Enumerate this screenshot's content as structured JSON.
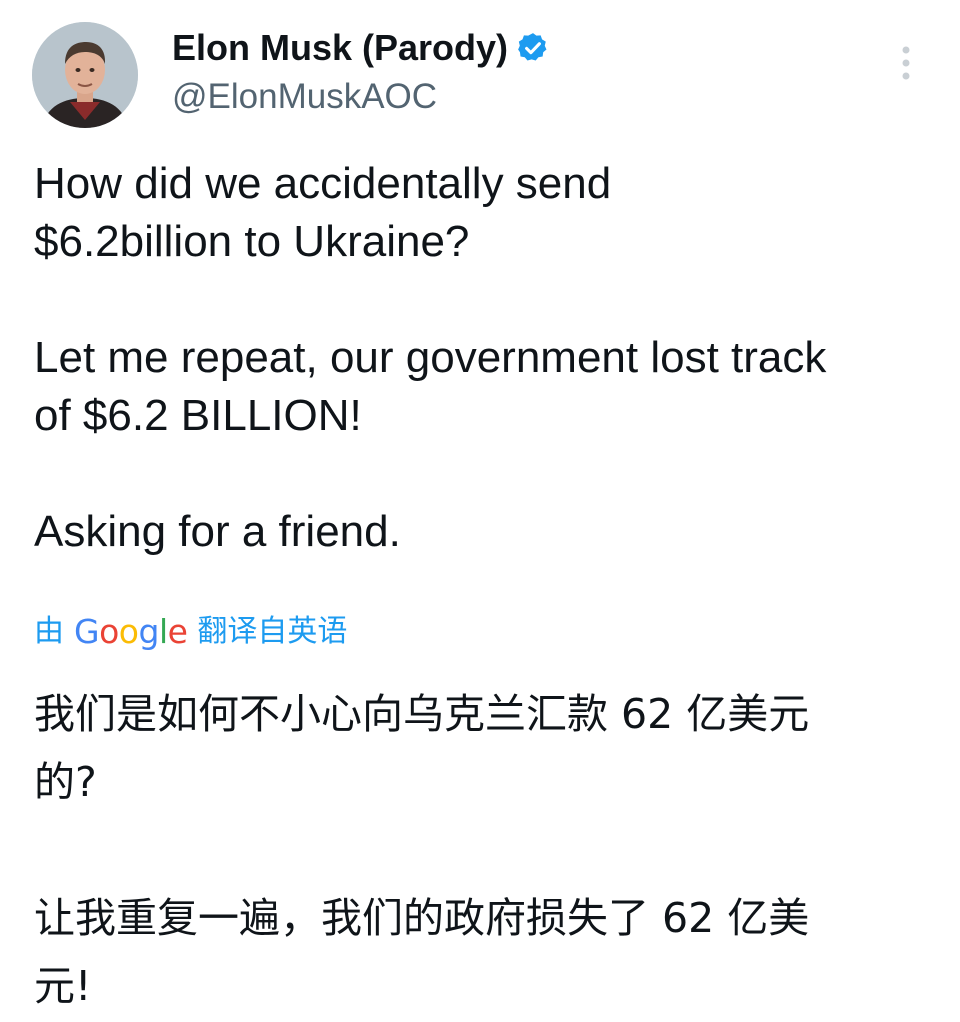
{
  "author": {
    "display_name": "Elon Musk (Parody)",
    "handle": "@ElonMuskAOC",
    "verified": true,
    "verified_color": "#1d9bf0"
  },
  "icons": {
    "avatar": "profile-photo",
    "verified": "verified-badge-icon",
    "more": "more-options-icon"
  },
  "tweet": {
    "paragraphs": [
      "How did we accidentally send\n$6.2billion to Ukraine?",
      "Let me repeat, our government lost track\nof $6.2 BILLION!",
      "Asking for a friend."
    ]
  },
  "translation": {
    "prefix": "由",
    "provider": "Google",
    "suffix": "翻译自英语",
    "link_color": "#1d9bf0",
    "paragraphs": [
      "我们是如何不小心向乌克兰汇款 62 亿美元\n的?",
      "让我重复一遍，我们的政府损失了 62 亿美\n元!"
    ]
  }
}
